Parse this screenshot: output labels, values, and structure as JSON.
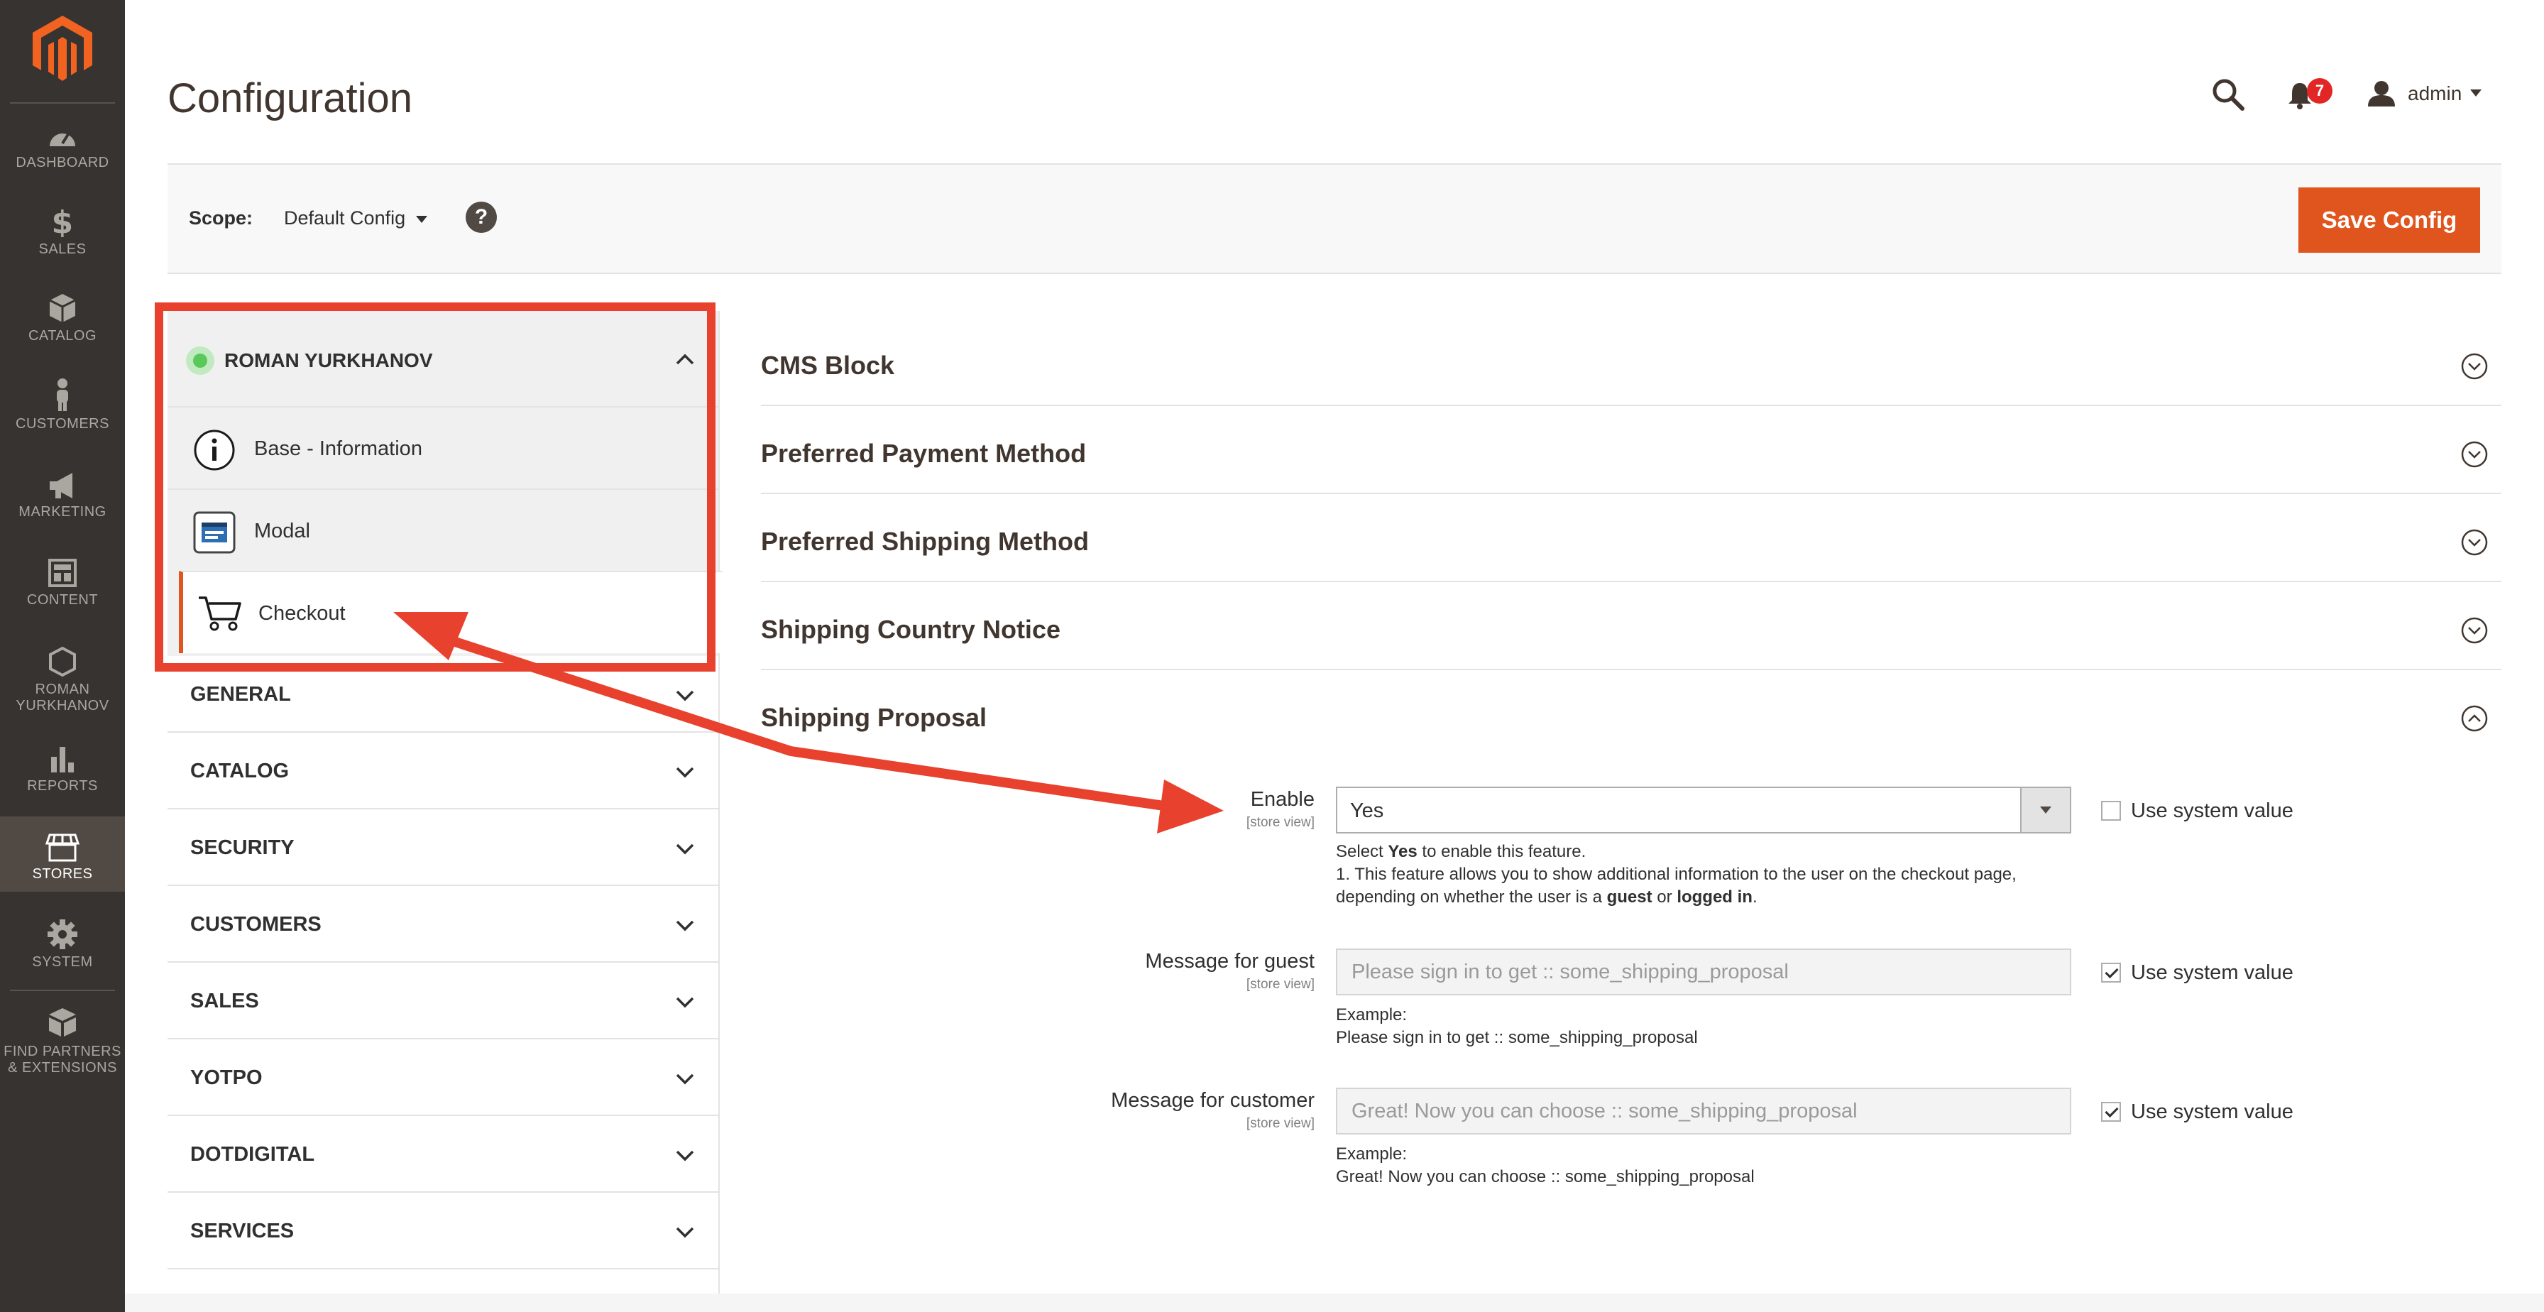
{
  "sidebar": {
    "items": [
      {
        "id": "dashboard",
        "label": "DASHBOARD",
        "icon": "dashboard-icon"
      },
      {
        "id": "sales",
        "label": "SALES",
        "icon": "dollar-icon"
      },
      {
        "id": "catalog",
        "label": "CATALOG",
        "icon": "box-icon"
      },
      {
        "id": "customers",
        "label": "CUSTOMERS",
        "icon": "person-icon"
      },
      {
        "id": "marketing",
        "label": "MARKETING",
        "icon": "megaphone-icon"
      },
      {
        "id": "content",
        "label": "CONTENT",
        "icon": "layout-icon"
      },
      {
        "id": "roman",
        "label_line1": "ROMAN",
        "label_line2": "YURKHANOV",
        "icon": "hexagon-icon"
      },
      {
        "id": "reports",
        "label": "REPORTS",
        "icon": "bar-chart-icon"
      },
      {
        "id": "stores",
        "label": "STORES",
        "icon": "store-icon",
        "active": true
      },
      {
        "id": "system",
        "label": "SYSTEM",
        "icon": "gear-icon"
      },
      {
        "id": "partners",
        "label_line1": "FIND PARTNERS",
        "label_line2": "& EXTENSIONS",
        "icon": "blocks-icon"
      }
    ]
  },
  "header": {
    "title": "Configuration",
    "notification_count": "7",
    "user_name": "admin"
  },
  "scope": {
    "label": "Scope:",
    "value": "Default Config",
    "help": "?",
    "save_label": "Save Config"
  },
  "config_nav": {
    "vendor": {
      "title": "ROMAN YURKHANOV",
      "items": [
        {
          "label": "Base - Information",
          "icon": "info-icon"
        },
        {
          "label": "Modal",
          "icon": "modal-icon"
        },
        {
          "label": "Checkout",
          "icon": "cart-icon",
          "active": true
        }
      ]
    },
    "groups": [
      "GENERAL",
      "CATALOG",
      "SECURITY",
      "CUSTOMERS",
      "SALES",
      "YOTPO",
      "DOTDIGITAL",
      "SERVICES"
    ]
  },
  "sections": [
    {
      "title": "CMS Block",
      "expanded": false
    },
    {
      "title": "Preferred Payment Method",
      "expanded": false
    },
    {
      "title": "Preferred Shipping Method",
      "expanded": false
    },
    {
      "title": "Shipping Country Notice",
      "expanded": false
    },
    {
      "title": "Shipping Proposal",
      "expanded": true
    }
  ],
  "shipping_proposal": {
    "enable": {
      "label": "Enable",
      "scope": "[store view]",
      "value": "Yes",
      "use_system_label": "Use system value",
      "use_system_checked": false,
      "note": {
        "l1_pre": "Select ",
        "l1_bold": "Yes",
        "l1_post": " to enable this feature.",
        "l2": "1. This feature allows you to show additional information to the user on the checkout page,",
        "l3_pre": "depending on whether the user is a ",
        "l3_b1": "guest",
        "l3_mid": " or ",
        "l3_b2": "logged in",
        "l3_post": "."
      }
    },
    "guest": {
      "label": "Message for guest",
      "scope": "[store view]",
      "placeholder": "Please sign in to get :: some_shipping_proposal",
      "use_system_label": "Use system value",
      "use_system_checked": true,
      "example_label": "Example:",
      "example_text": "Please sign in to get :: some_shipping_proposal"
    },
    "customer": {
      "label": "Message for customer",
      "scope": "[store view]",
      "placeholder": "Great! Now you can choose :: some_shipping_proposal",
      "use_system_label": "Use system value",
      "use_system_checked": true,
      "example_label": "Example:",
      "example_text": "Great! Now you can choose :: some_shipping_proposal"
    }
  },
  "colors": {
    "sidebar_bg": "#373330",
    "accent": "#e0541e",
    "annotation": "#e8412d",
    "notification": "#e22626"
  }
}
